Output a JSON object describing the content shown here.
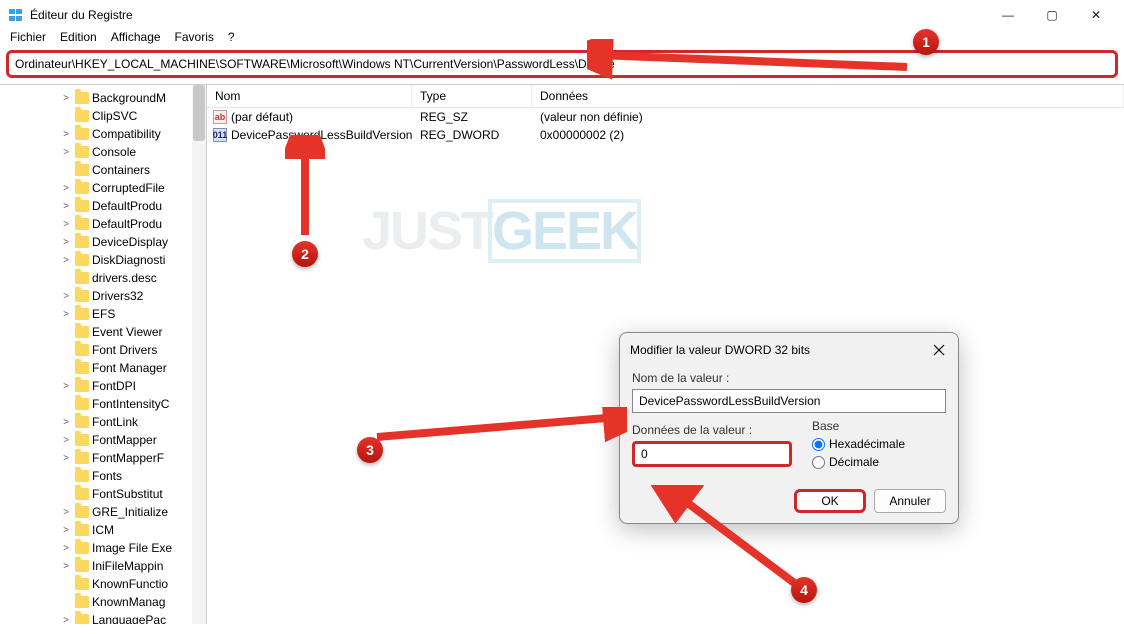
{
  "window": {
    "title": "Éditeur du Registre",
    "minimize": "—",
    "maximize": "▢",
    "close": "✕"
  },
  "menu": {
    "fichier": "Fichier",
    "edition": "Edition",
    "affichage": "Affichage",
    "favoris": "Favoris",
    "aide": "?"
  },
  "address": "Ordinateur\\HKEY_LOCAL_MACHINE\\SOFTWARE\\Microsoft\\Windows NT\\CurrentVersion\\PasswordLess\\Device",
  "columns": {
    "nom": "Nom",
    "type": "Type",
    "donnees": "Données"
  },
  "rows": [
    {
      "name": "(par défaut)",
      "type": "REG_SZ",
      "data": "(valeur non définie)",
      "icon": "ab"
    },
    {
      "name": "DevicePasswordLessBuildVersion",
      "type": "REG_DWORD",
      "data": "0x00000002 (2)",
      "icon": "dw"
    }
  ],
  "tree": [
    {
      "label": "BackgroundM",
      "chev": ">"
    },
    {
      "label": "ClipSVC"
    },
    {
      "label": "Compatibility",
      "chev": ">"
    },
    {
      "label": "Console",
      "chev": ">"
    },
    {
      "label": "Containers"
    },
    {
      "label": "CorruptedFile",
      "chev": ">"
    },
    {
      "label": "DefaultProdu",
      "chev": ">"
    },
    {
      "label": "DefaultProdu",
      "chev": ">"
    },
    {
      "label": "DeviceDisplay",
      "chev": ">"
    },
    {
      "label": "DiskDiagnosti",
      "chev": ">"
    },
    {
      "label": "drivers.desc"
    },
    {
      "label": "Drivers32",
      "chev": ">"
    },
    {
      "label": "EFS",
      "chev": ">"
    },
    {
      "label": "Event Viewer"
    },
    {
      "label": "Font Drivers"
    },
    {
      "label": "Font Manager"
    },
    {
      "label": "FontDPI",
      "chev": ">"
    },
    {
      "label": "FontIntensityC"
    },
    {
      "label": "FontLink",
      "chev": ">"
    },
    {
      "label": "FontMapper",
      "chev": ">"
    },
    {
      "label": "FontMapperF",
      "chev": ">"
    },
    {
      "label": "Fonts"
    },
    {
      "label": "FontSubstitut"
    },
    {
      "label": "GRE_Initialize",
      "chev": ">"
    },
    {
      "label": "ICM",
      "chev": ">"
    },
    {
      "label": "Image File Exe",
      "chev": ">"
    },
    {
      "label": "IniFileMappin",
      "chev": ">"
    },
    {
      "label": "KnownFunctio"
    },
    {
      "label": "KnownManag"
    },
    {
      "label": "LanguagePac",
      "chev": ">"
    }
  ],
  "dialog": {
    "title": "Modifier la valeur DWORD 32 bits",
    "name_label": "Nom de la valeur :",
    "name_value": "DevicePasswordLessBuildVersion",
    "data_label": "Données de la valeur :",
    "data_value": "0",
    "base_label": "Base",
    "base_hex": "Hexadécimale",
    "base_dec": "Décimale",
    "ok": "OK",
    "cancel": "Annuler"
  },
  "badges": {
    "b1": "1",
    "b2": "2",
    "b3": "3",
    "b4": "4"
  },
  "watermark": {
    "just": "JUST",
    "geek": "GEEK"
  }
}
